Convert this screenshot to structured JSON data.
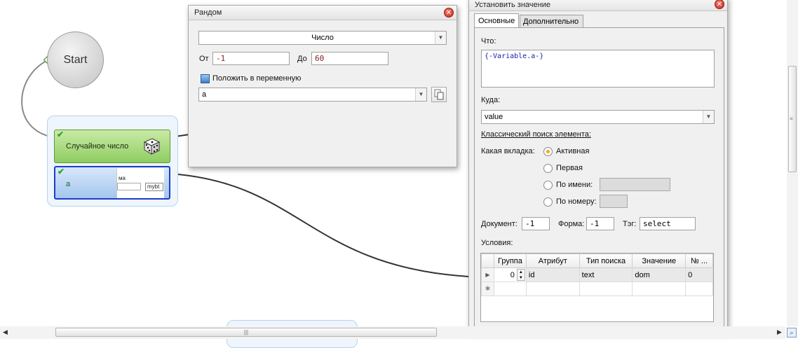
{
  "canvas": {
    "start_label": "Start",
    "node_random": "Случайное число",
    "node_set_value": "a",
    "node_preview_lines": [
      "ма",
      "mybt"
    ]
  },
  "random_window": {
    "title": "Рандом",
    "type_value": "Число",
    "from_label": "От",
    "from_value": "-1",
    "to_label": "До",
    "to_value": "60",
    "put_var_label": "Положить в переменную",
    "variable_value": "a"
  },
  "set_value_window": {
    "title": "Установить значение",
    "tabs": [
      "Основные",
      "Дополнительно"
    ],
    "what_label": "Что:",
    "what_value": "{-Variable.a-}",
    "where_label": "Куда:",
    "where_value": "value",
    "classic_search_label": "Классический поиск элемента:",
    "tab_question_label": "Какая вкладка:",
    "radio_options": [
      "Активная",
      "Первая",
      "По имени:",
      "По номеру:"
    ],
    "selected_radio": "Активная",
    "document_label": "Документ:",
    "document_value": "-1",
    "form_label": "Форма:",
    "form_value": "-1",
    "tag_label": "Тэг:",
    "tag_value": "select",
    "conditions_label": "Условия:",
    "grid_headers": [
      "Группа",
      "Атрибут",
      "Тип поиска",
      "Значение",
      "№ ..."
    ],
    "grid_rows": [
      {
        "group": "0",
        "attribute": "id",
        "search_type": "text",
        "value": "dom",
        "number": "0"
      }
    ]
  },
  "scrollbar": {
    "grip": "|||"
  }
}
